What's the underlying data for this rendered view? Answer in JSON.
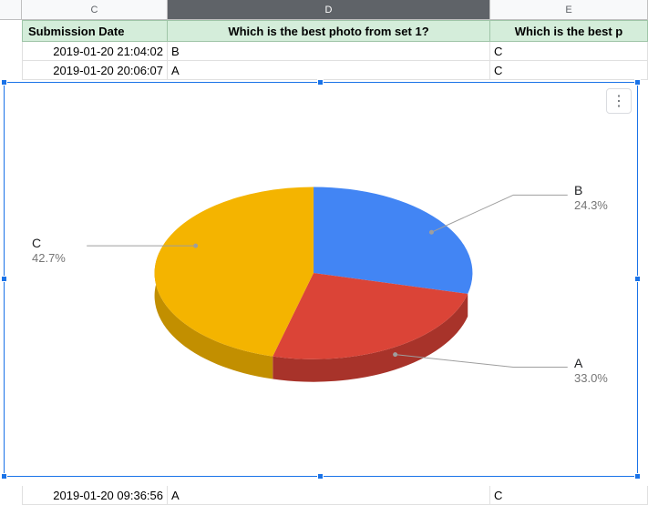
{
  "columns": {
    "C": {
      "letter": "C",
      "header": "Submission Date"
    },
    "D": {
      "letter": "D",
      "header": "Which is the best photo from set 1?"
    },
    "E": {
      "letter": "E",
      "header": "Which is the best p"
    }
  },
  "rows": [
    {
      "date": "2019-01-20 21:04:02",
      "d": "B",
      "e": "C"
    },
    {
      "date": "2019-01-20 20:06:07",
      "d": "A",
      "e": "C"
    }
  ],
  "bottom_row": {
    "date": "2019-01-20 09:36:56",
    "d": "A",
    "e": "C"
  },
  "chart_menu_glyph": "⋮",
  "chart_data": {
    "type": "pie",
    "title": "",
    "series": [
      {
        "name": "B",
        "value": 24.3,
        "label": "24.3%",
        "color": "#4285F4"
      },
      {
        "name": "A",
        "value": 33.0,
        "label": "33.0%",
        "color": "#DB4437"
      },
      {
        "name": "C",
        "value": 42.7,
        "label": "42.7%",
        "color": "#F4B400"
      }
    ]
  }
}
